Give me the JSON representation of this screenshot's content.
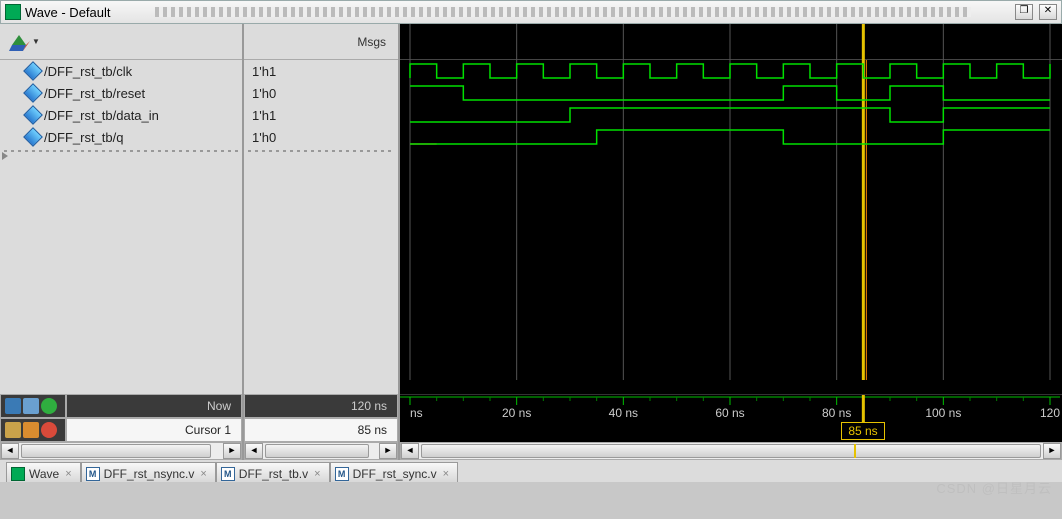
{
  "window": {
    "title": "Wave - Default"
  },
  "header": {
    "msgs_label": "Msgs"
  },
  "signals": [
    {
      "name": "/DFF_rst_tb/clk",
      "value": "1'h1"
    },
    {
      "name": "/DFF_rst_tb/reset",
      "value": "1'h0"
    },
    {
      "name": "/DFF_rst_tb/data_in",
      "value": "1'h1"
    },
    {
      "name": "/DFF_rst_tb/q",
      "value": "1'h0"
    }
  ],
  "footer": {
    "now_label": "Now",
    "now_value": "120 ns",
    "cursor_label": "Cursor 1",
    "cursor_value": "85 ns",
    "cursor_marker": "85 ns"
  },
  "ruler": {
    "ticks": [
      "ns",
      "20 ns",
      "40 ns",
      "60 ns",
      "80 ns",
      "100 ns",
      "120"
    ]
  },
  "tabs": [
    {
      "label": "Wave",
      "icon": "wave"
    },
    {
      "label": "DFF_rst_nsync.v",
      "icon": "m"
    },
    {
      "label": "DFF_rst_tb.v",
      "icon": "m"
    },
    {
      "label": "DFF_rst_sync.v",
      "icon": "m"
    }
  ],
  "watermark": "CSDN @日星月云",
  "chart_data": {
    "type": "waveform",
    "time_unit": "ns",
    "time_range": [
      0,
      120
    ],
    "cursor": 85,
    "grid_major": [
      0,
      20,
      40,
      60,
      80,
      100,
      120
    ],
    "signals": {
      "clk": {
        "period": 10,
        "duty": 0.5,
        "phase": 0,
        "kind": "clock"
      },
      "reset": {
        "kind": "piecewise",
        "edges": [
          [
            0,
            1
          ],
          [
            10,
            0
          ],
          [
            70,
            1
          ],
          [
            80,
            0
          ],
          [
            90,
            1
          ],
          [
            100,
            0
          ]
        ]
      },
      "data_in": {
        "kind": "piecewise",
        "edges": [
          [
            0,
            0
          ],
          [
            30,
            1
          ],
          [
            90,
            0
          ],
          [
            100,
            1
          ]
        ]
      },
      "q": {
        "kind": "piecewise",
        "edges": [
          [
            0,
            0
          ],
          [
            35,
            1
          ],
          [
            70,
            0
          ],
          [
            100,
            1
          ]
        ],
        "init_red_until": 5
      }
    }
  }
}
